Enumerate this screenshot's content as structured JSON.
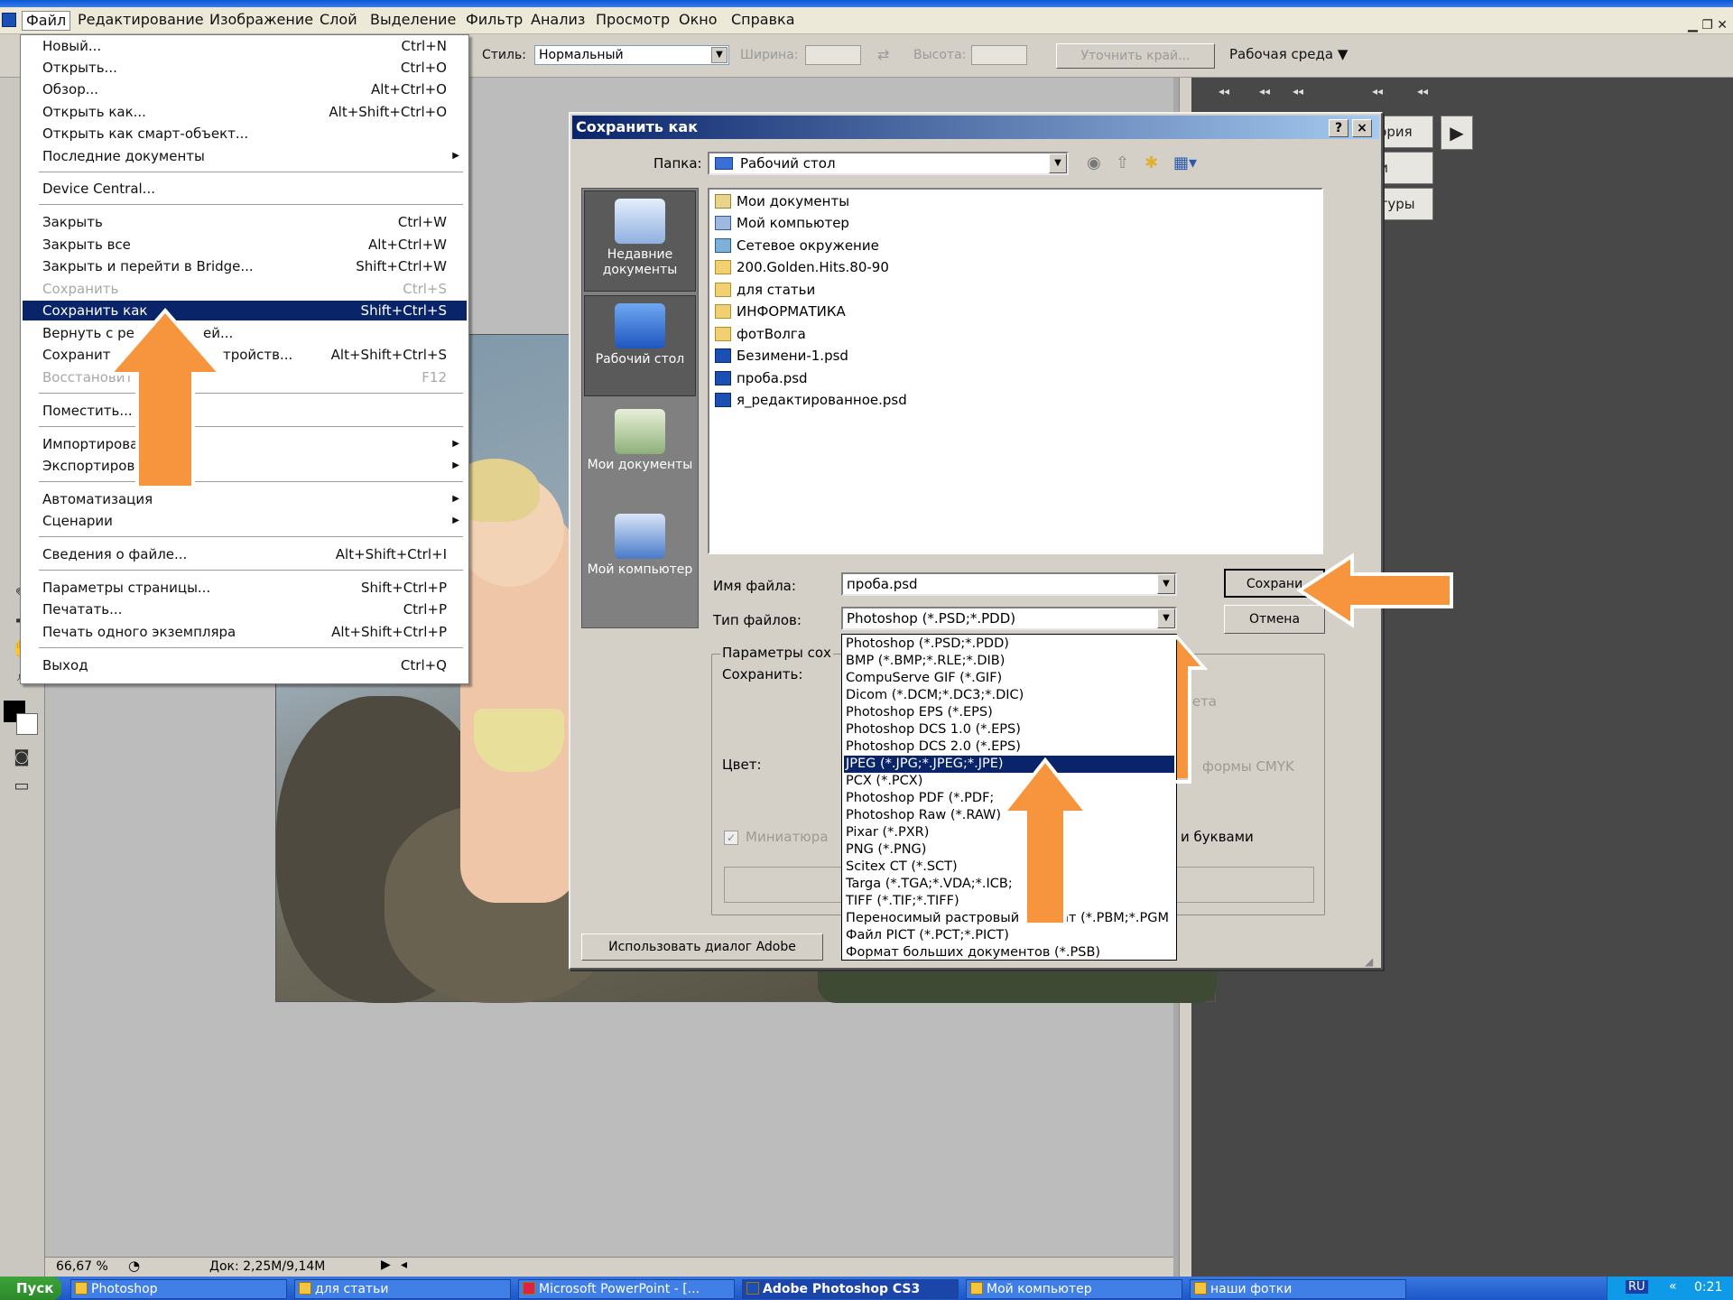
{
  "menubar": {
    "items": [
      "Файл",
      "Редактирование",
      "Изображение",
      "Слой",
      "Выделение",
      "Фильтр",
      "Анализ",
      "Просмотр",
      "Окно",
      "Справка"
    ]
  },
  "options_bar": {
    "style_label": "Стиль:",
    "style_value": "Нормальный",
    "width_label": "Ширина:",
    "height_label": "Высота:",
    "refine_button": "Уточнить край...",
    "workspace": "Рабочая среда ▼"
  },
  "file_menu": {
    "items": [
      {
        "label": "Новый...",
        "shortcut": "Ctrl+N"
      },
      {
        "label": "Открыть...",
        "shortcut": "Ctrl+O"
      },
      {
        "label": "Обзор...",
        "shortcut": "Alt+Ctrl+O"
      },
      {
        "label": "Открыть как...",
        "shortcut": "Alt+Shift+Ctrl+O"
      },
      {
        "label": "Открыть как смарт-объект...",
        "shortcut": ""
      },
      {
        "label": "Последние документы",
        "shortcut": ""
      },
      {
        "label": "Device Central...",
        "shortcut": ""
      },
      {
        "label": "Закрыть",
        "shortcut": "Ctrl+W"
      },
      {
        "label": "Закрыть все",
        "shortcut": "Alt+Ctrl+W"
      },
      {
        "label": "Закрыть и перейти в Bridge...",
        "shortcut": "Shift+Ctrl+W"
      },
      {
        "label": "Сохранить",
        "shortcut": "Ctrl+S"
      },
      {
        "label": "Сохранить как...",
        "shortcut": "Shift+Ctrl+S"
      },
      {
        "label": "Вернуть с ре",
        "shortcut": "ей..."
      },
      {
        "label": "Сохранит",
        "shortcut": "тройств..."
      },
      {
        "label": "Восстановит",
        "shortcut": "F12"
      },
      {
        "label": "Поместить...",
        "shortcut": ""
      },
      {
        "label": "Импортирова",
        "shortcut": ""
      },
      {
        "label": "Экспортиров",
        "shortcut": ""
      },
      {
        "label": "Автоматизация",
        "shortcut": ""
      },
      {
        "label": "Сценарии",
        "shortcut": ""
      },
      {
        "label": "Сведения о файле...",
        "shortcut": "Alt+Shift+Ctrl+I"
      },
      {
        "label": "Параметры страницы...",
        "shortcut": "Shift+Ctrl+P"
      },
      {
        "label": "Печатать...",
        "shortcut": "Ctrl+P"
      },
      {
        "label": "Печать одного экземпляра",
        "shortcut": "Alt+Shift+Ctrl+P"
      },
      {
        "label": "Выход",
        "shortcut": "Ctrl+Q"
      }
    ],
    "save_as_label": "Сохранить как",
    "save_as_shortcut": "Shift+Ctrl+S",
    "return_shortcut": "Alt+Shift+Ctrl+S"
  },
  "dialog": {
    "title": "Сохранить как",
    "help_btn": "?",
    "close_btn": "×",
    "folder_label": "Папка:",
    "folder_value": "Рабочий стол",
    "places": [
      "Недавние документы",
      "Рабочий стол",
      "Мои документы",
      "Мой компьютер"
    ],
    "files": [
      "Мои документы",
      "Мой компьютер",
      "Сетевое окружение",
      "200.Golden.Hits.80-90",
      "для статьи",
      "ИНФОРМАТИКА",
      "фотВолга",
      "Безимени-1.psd",
      "проба.psd",
      "я_редактированное.psd"
    ],
    "filename_label": "Имя файла:",
    "filename_value": "проба.psd",
    "filetype_label": "Тип файлов:",
    "filetype_value": "Photoshop (*.PSD;*.PDD)",
    "save_button": "Сохрани",
    "cancel_button": "Отмена",
    "params_title": "Параметры сох",
    "save_sub": "Сохранить:",
    "color_label": "Цвет:",
    "thumbnail_label": "Миниатюра",
    "color_profile_partial": "вета",
    "cmyk_partial": "формы CMYK",
    "lowercase_partial": "и буквами",
    "adobe_dialog_button": "Использовать диалог Adobe",
    "types": [
      "Photoshop (*.PSD;*.PDD)",
      "BMP (*.BMP;*.RLE;*.DIB)",
      "CompuServe GIF (*.GIF)",
      "Dicom (*.DCM;*.DC3;*.DIC)",
      "Photoshop EPS (*.EPS)",
      "Photoshop DCS 1.0 (*.EPS)",
      "Photoshop DCS 2.0 (*.EPS)",
      "JPEG (*.JPG;*.JPEG;*.JPE)",
      "PCX (*.PCX)",
      "Photoshop PDF (*.PDF;",
      "Photoshop Raw (*.RAW)",
      "Pixar (*.PXR)",
      "PNG (*.PNG)",
      "Scitex CT (*.SCT)",
      "Targa (*.TGA;*.VDA;*.ICB;",
      "TIFF (*.TIF;*.TIFF)",
      "Переносимый растровый формат (*.PBM;*.PGM",
      "Файл PICT (*.PCT;*.PICT)",
      "Формат больших документов (*.PSB)"
    ]
  },
  "panels": {
    "history": "История",
    "layers": "Слои",
    "paths": "Контуры"
  },
  "status": {
    "zoom": "66,67 %",
    "doc": "Док: 2,25M/9,14M"
  },
  "taskbar": {
    "start": "Пуск",
    "tasks": [
      "Photoshop",
      "для статьи",
      "Microsoft PowerPoint - [...",
      "Adobe Photoshop CS3",
      "Мой компьютер",
      "наши фотки"
    ],
    "lang": "RU",
    "time": "0:21"
  },
  "colors": {
    "accent_arrow": "#f7953f",
    "selection": "#0a246a"
  }
}
